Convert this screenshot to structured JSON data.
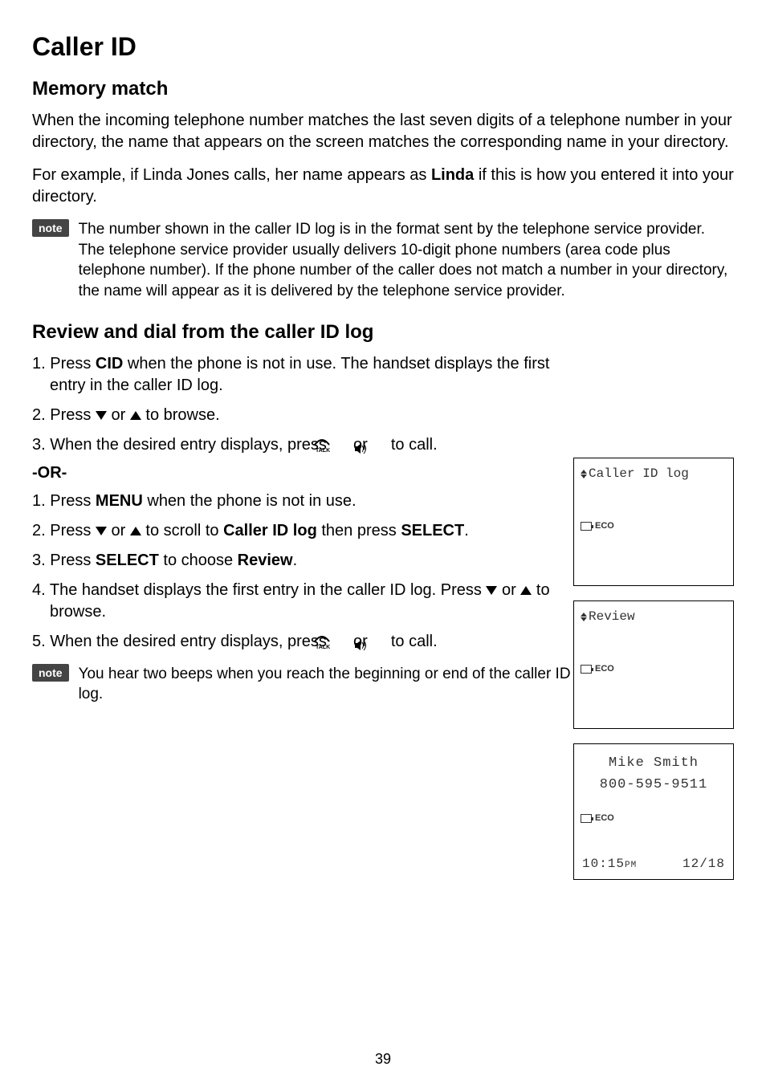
{
  "title": "Caller ID",
  "section1": {
    "heading": "Memory match",
    "p1_a": "When the incoming telephone number matches the last seven digits of a telephone number in your directory, the name that appears on the screen matches the corresponding name in your directory.",
    "p2_a": "For example, if Linda Jones calls, her name appears as ",
    "p2_bold": "Linda",
    "p2_b": " if this is how you entered it into your directory.",
    "note": "The number shown in the caller ID log is in the format sent by the telephone service provider. The telephone service provider usually delivers 10-digit phone numbers (area code plus telephone number). If the phone number of the caller does not match a number in your directory, the name will appear as it is delivered by the telephone service provider."
  },
  "section2": {
    "heading": "Review and dial from the caller ID log",
    "step1_a": "1. Press ",
    "step1_b": "CID",
    "step1_c": " when the phone is not in use. The handset displays the first entry in the caller ID log.",
    "step2_a": "2. Press ",
    "step2_or": " or ",
    "step2_b": " to browse.",
    "step3_a": "3. When the desired entry displays, press ",
    "step3_or": " or ",
    "step3_b": " to call.",
    "or_label": "-OR-",
    "alt1_a": "1. Press ",
    "alt1_b": "MENU",
    "alt1_c": " when the phone is not in use.",
    "alt2_a": "2. Press ",
    "alt2_or": " or ",
    "alt2_b": " to scroll to ",
    "alt2_c": "Caller ID log",
    "alt2_d": " then press ",
    "alt2_e": "SELECT",
    "alt2_f": ".",
    "alt3_a": "3. Press ",
    "alt3_b": "SELECT",
    "alt3_c": " to choose ",
    "alt3_d": "Review",
    "alt3_e": ".",
    "alt4_a": "4. The handset displays the first entry in the caller ID log. Press ",
    "alt4_or": " or ",
    "alt4_b": " to browse.",
    "alt5_a": "5. When the desired entry displays, press ",
    "alt5_or": " or ",
    "alt5_b": " to call.",
    "note": "You hear two beeps when you reach the beginning or end of the caller ID log."
  },
  "lcd1": {
    "title": "Caller ID log",
    "eco": "ECO"
  },
  "lcd2": {
    "title": "Review",
    "eco": "ECO"
  },
  "lcd3": {
    "name": "Mike Smith",
    "number": "800-595-9511",
    "eco": "ECO",
    "time": "10:15",
    "ampm": "PM",
    "date": "12/18"
  },
  "note_label": "note",
  "page_number": "39"
}
